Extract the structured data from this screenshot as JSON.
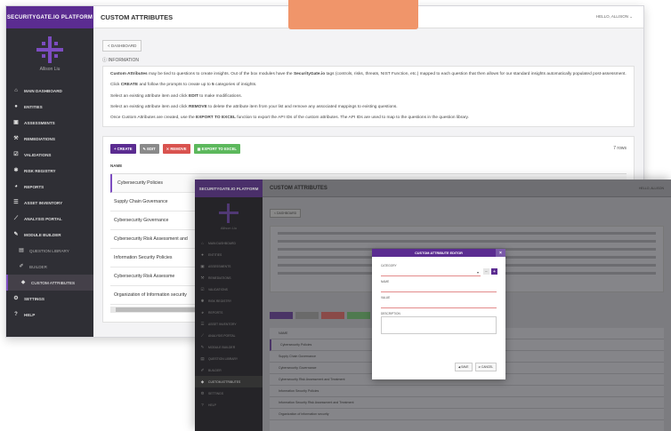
{
  "brand": "SECURITYGATE.IO PLATFORM",
  "user": "Allison Liu",
  "colors": {
    "purple": "#5b2c91",
    "accent": "#7c4cc0",
    "create": "#5b2c91",
    "edit": "#888888",
    "remove": "#d9534f",
    "export": "#5cb85c",
    "orange": "#f0956a"
  },
  "nav": [
    {
      "label": "MAIN DASHBOARD",
      "icon": "home-icon"
    },
    {
      "label": "ENTITIES",
      "icon": "users-icon"
    },
    {
      "label": "ASSESSMENTS",
      "icon": "clipboard-icon"
    },
    {
      "label": "REMEDIATIONS",
      "icon": "wrench-icon"
    },
    {
      "label": "VALIDATIONS",
      "icon": "check-icon"
    },
    {
      "label": "RISK REGISTRY",
      "icon": "bug-icon"
    },
    {
      "label": "REPORTS",
      "icon": "pie-icon"
    },
    {
      "label": "ASSET INVENTORY",
      "icon": "layers-icon"
    },
    {
      "label": "ANALYSIS PORTAL",
      "icon": "chart-icon"
    },
    {
      "label": "MODULE BUILDER",
      "icon": "tool-icon"
    }
  ],
  "nav_sub": [
    "QUESTION LIBRARY",
    "BUILDER",
    "CUSTOM ATTRIBUTES"
  ],
  "nav_bottom": [
    {
      "label": "SETTINGS",
      "icon": "gears-icon"
    },
    {
      "label": "HELP",
      "icon": "help-icon"
    }
  ],
  "header": {
    "title": "CUSTOM ATTRIBUTES",
    "hello": "HELLO, ALLISON"
  },
  "dashboard_button": "< DASHBOARD",
  "info": {
    "heading": "INFORMATION",
    "p1_bold": "Custom Attributes",
    "p1_mid": " may be tied to questions to create insights. Out of the box modules have the ",
    "p1_brand": "SecurityGate.io",
    "p1_tail": " tags (controls, risks, threats, NIST Function, etc.) mapped to each question that then allows for our standard insights automatically populated post-assessment.",
    "p2a": "Click ",
    "p2b": "CREATE",
    "p2c": " and follow the prompts to create up to ",
    "p2d": "5",
    "p2e": " categories of insights.",
    "p3a": "Select an existing attribute item and click ",
    "p3b": "EDIT",
    "p3c": " to make modifications.",
    "p4a": "Select an existing attribute item and click ",
    "p4b": "REMOVE",
    "p4c": " to delete the attribute item from your list and remove any associated mappings to existing questions.",
    "p5a": "Once Custom Attributes are created, use the ",
    "p5b": "EXPORT TO EXCEL",
    "p5c": " function to export the API IDs of the custom attributes. The API IDs are used to map to the questions in the question library."
  },
  "toolbar": {
    "create": "+ CREATE",
    "edit": "✎ EDIT",
    "remove": "✕ REMOVE",
    "export": "▦ EXPORT TO EXCEL",
    "rows": "7 rows"
  },
  "table": {
    "header": "NAME",
    "rows": [
      "Cybersecurity Policies",
      "Supply Chain Governance",
      "Cybersecurity Governance",
      "Cybersecurity Risk Assessment and",
      "Information Security Policies",
      "Cybersecurity Risk Assessme",
      "Organization of Information security"
    ]
  },
  "front": {
    "title": "CUSTOM ATTRIBUTES",
    "dashboard": "< DASHBOARD",
    "rows": [
      "Cybersecurity Policies",
      "Supply Chain Governance",
      "Cybersecurity Governance",
      "Cybersecurity Risk Assessment and Treatment",
      "Information Security Policies",
      "Information Security Risk Assessment and Treatment",
      "Organization of information security"
    ]
  },
  "modal": {
    "title": "CUSTOM ATTRIBUTE EDITOR",
    "category": "CATEGORY",
    "name": "NAME",
    "value": "VALUE",
    "description": "DESCRIPTION",
    "save": "◀ SAVE",
    "cancel": "⊘ CANCEL"
  }
}
